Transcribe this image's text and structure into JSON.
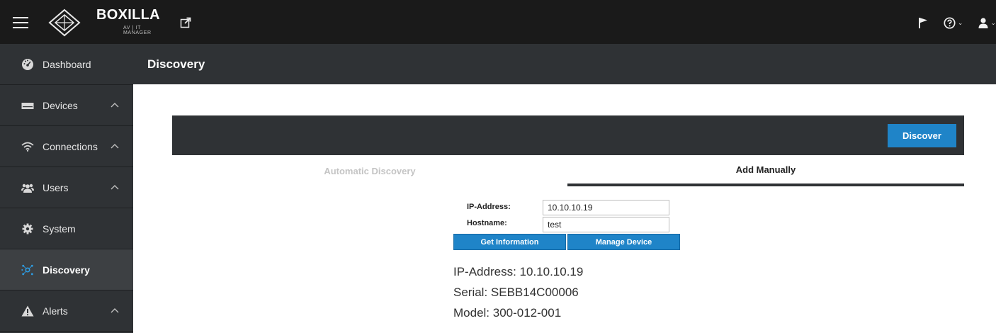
{
  "app": {
    "brand_name": "BOXILLA",
    "brand_sub": "AV | IT MANAGER"
  },
  "sidebar": {
    "items": [
      {
        "label": "Dashboard"
      },
      {
        "label": "Devices"
      },
      {
        "label": "Connections"
      },
      {
        "label": "Users"
      },
      {
        "label": "System"
      },
      {
        "label": "Discovery"
      },
      {
        "label": "Alerts"
      }
    ]
  },
  "page": {
    "title": "Discovery"
  },
  "panel": {
    "discover_label": "Discover",
    "tabs": [
      {
        "label": "Automatic Discovery"
      },
      {
        "label": "Add Manually"
      }
    ],
    "form": {
      "ip_label": "IP-Address:",
      "ip_value": "10.10.10.19",
      "hostname_label": "Hostname:",
      "hostname_value": "test",
      "get_info_label": "Get Information",
      "manage_label": "Manage Device"
    },
    "result": {
      "ip": "IP-Address: 10.10.10.19",
      "serial": "Serial: SEBB14C00006",
      "model": "Model: 300-012-001"
    }
  },
  "colors": {
    "topbar": "#1a1a1a",
    "sidebar": "#2f3235",
    "accent_blue": "#1f84c8"
  }
}
